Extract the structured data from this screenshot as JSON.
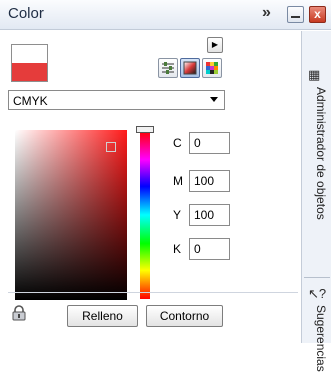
{
  "window": {
    "title": "Color",
    "collapse_glyph": "»",
    "close_glyph": "x"
  },
  "dock_tabs": [
    {
      "label": "Administrador de objetos",
      "icon": "object-manager-icon"
    },
    {
      "label": "Sugerencias",
      "icon": "hints-icon"
    }
  ],
  "color_model": {
    "selected": "CMYK"
  },
  "channels": [
    {
      "label": "C",
      "value": "0"
    },
    {
      "label": "M",
      "value": "100"
    },
    {
      "label": "Y",
      "value": "100"
    },
    {
      "label": "K",
      "value": "0"
    }
  ],
  "buttons": {
    "fill_label": "Relleno",
    "outline_label": "Contorno"
  },
  "colors": {
    "current_color": "#e53c3b",
    "accent": "#4f6b9d"
  },
  "icons": {
    "menu": "triangle-right-icon",
    "sliders": "sliders-icon",
    "viewer": "color-viewer-icon",
    "palette": "palette-grid-icon",
    "lock": "lock-icon"
  }
}
